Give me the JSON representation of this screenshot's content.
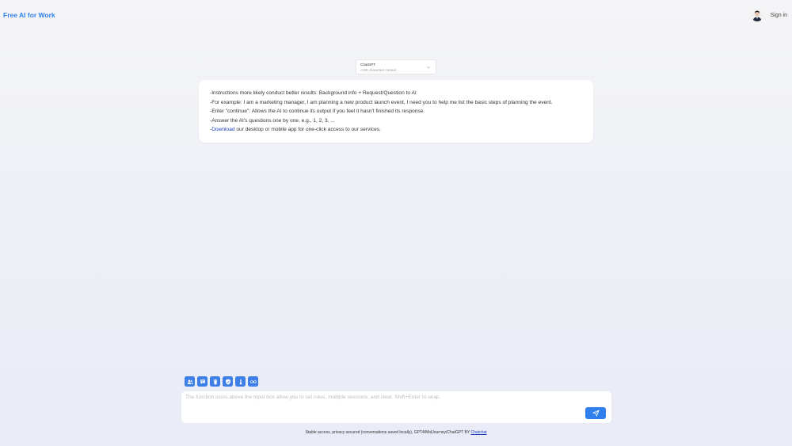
{
  "header": {
    "brand": "Free AI for Work",
    "signin_label": "Sign in"
  },
  "model_select": {
    "name": "ChatGPT",
    "sub": "<10K characters context"
  },
  "intro": {
    "line1": "-Instructions more likely conduct better results: Background info + Request/Question to AI",
    "line2": "-For example: I am a marketing manager, I am planning a new product launch event, I need you to help me list the basic steps of planning the event.",
    "line3": "-Enter \"continue\": Allows the AI to continue its output if you feel it hasn't finished its response.",
    "line4": "-Answer the AI's questions one by one, e.g., 1, 2, 3, ...",
    "line5_prefix": "-",
    "line5_link": "Download",
    "line5_suffix": " our desktop or mobile app for one-click access to our services."
  },
  "tools": [
    "roles-icon",
    "chat-icon",
    "trash-icon",
    "shield-icon",
    "thermometer-icon",
    "infinity-icon"
  ],
  "input": {
    "placeholder": "The function icons above the input box allow you to set roles, multiple sessions, and clear. Shift+Enter to wrap.",
    "value": ""
  },
  "footer": {
    "text": "Stable access, privacy secured (conversations saved locally), GPT4/MidJourney/ChatGPT BY ",
    "link": "Chatchat"
  },
  "colors": {
    "accent": "#2f80ed",
    "tool_button": "#3d7fe6",
    "link": "#1d3fbf"
  }
}
